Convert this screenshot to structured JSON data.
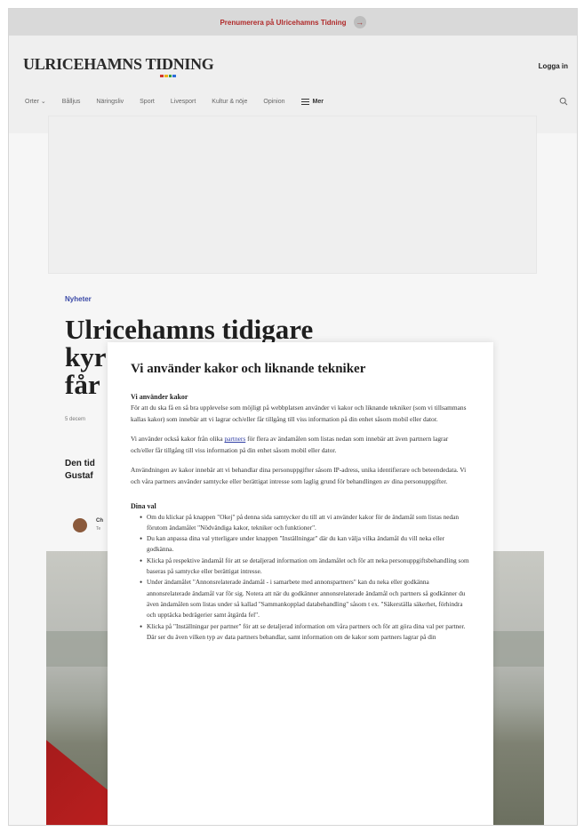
{
  "promo": {
    "text": "Prenumerera på Ulricehamns Tidning"
  },
  "header": {
    "logo": "ULRICEHAMNS TIDNING",
    "login": "Logga in"
  },
  "nav": {
    "items": [
      "Orter",
      "Bålljus",
      "Näringsliv",
      "Sport",
      "Livesport",
      "Kultur & nöje",
      "Opinion"
    ],
    "more": "Mer"
  },
  "article": {
    "kicker": "Nyheter",
    "headline_lines": [
      "Ulricehamns tidigare",
      "kyr",
      "får"
    ],
    "date": "5 decem",
    "lead_lines": [
      "Den tid",
      "Gustaf"
    ],
    "author_name": "Ch",
    "author_sub": "Te"
  },
  "modal": {
    "title": "Vi använder kakor och liknande tekniker",
    "section1_heading": "Vi använder kakor",
    "p1": "För att du ska få en så bra upplevelse som möjligt på webbplatsen använder vi kakor och liknande tekniker (som vi tillsammans kallas kakor) som innebär att vi lagrar och/eller får tillgång till viss information på din enhet såsom mobil eller dator.",
    "p2_before": "Vi använder också kakor från olika ",
    "p2_link": "partners",
    "p2_after": " för flera av ändamålen som listas nedan som innebär att även partnern lagrar och/eller får tillgång till viss information på din enhet såsom mobil eller dator.",
    "p3": "Användningen av kakor innebär att vi behandlar dina personuppgifter såsom IP-adress, unika identifierare och beteendedata. Vi och våra partners använder samtycke eller berättigat intresse som laglig grund för behandlingen av dina personuppgifter.",
    "section2_heading": "Dina val",
    "bullets": [
      "Om du klickar på knappen \"Okej\" på denna sida samtycker du till att vi använder kakor för de ändamål som listas nedan förutom ändamålet \"Nödvändiga kakor, tekniker och funktioner\".",
      "Du kan anpassa dina val ytterligare under knappen \"Inställningar\" där du kan välja vilka ändamål du vill neka eller godkänna.",
      "Klicka på respektive ändamål för att se detaljerad information om ändamålet och för att neka personuppgiftsbehandling som baseras på samtycke eller berättigat intresse.",
      "Under ändamålet \"Annonsrelaterade ändamål - i samarbete med annonspartners\" kan du neka eller godkänna annonsrelaterade ändamål var för sig. Notera att när du godkänner annonsrelaterade ändamål och partners så godkänner du även ändamålen som listas under så kallad \"Sammankopplad databehandling\" såsom t ex. \"Säkerställa säkerhet, förhindra och upptäcka bedrägerier samt åtgärda fel\".",
      "Klicka på \"Inställningar per partner\" för att se detaljerad information om våra partners och för att göra dina val per partner. Där ser du även vilken typ av data partners behandlar, samt information om de kakor som partners lagrar på din"
    ]
  }
}
